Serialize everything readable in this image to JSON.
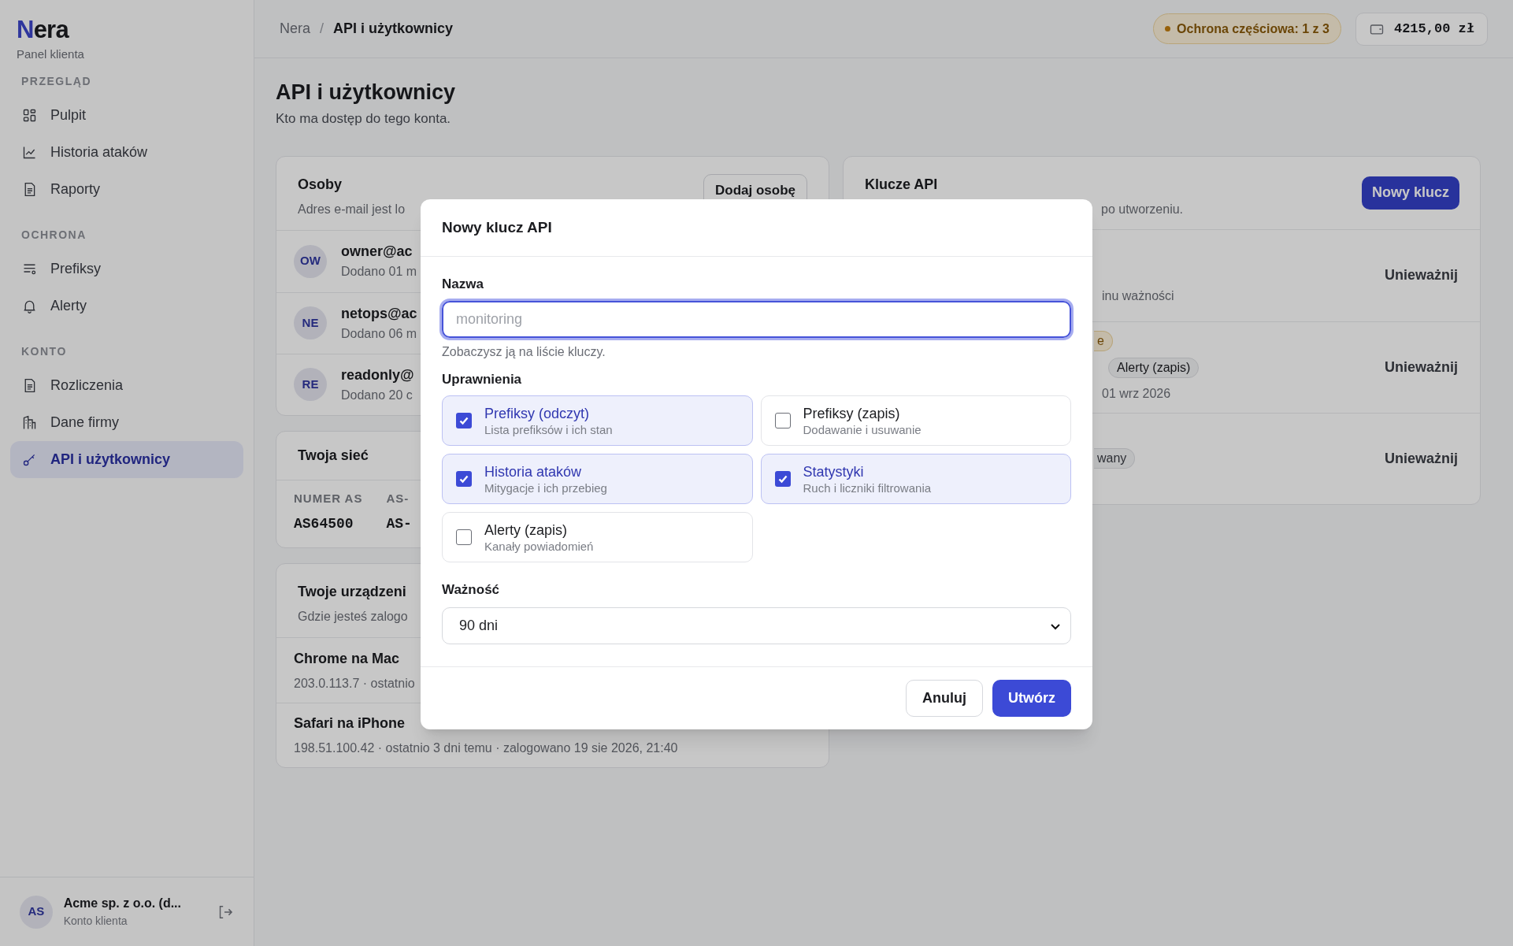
{
  "sidebar": {
    "logo": "Nera",
    "subtitle": "Panel klienta",
    "sections": [
      {
        "heading": "PRZEGLĄD",
        "items": [
          {
            "label": "Pulpit",
            "selected": false
          },
          {
            "label": "Historia ataków",
            "selected": false
          },
          {
            "label": "Raporty",
            "selected": false
          }
        ]
      },
      {
        "heading": "OCHRONA",
        "items": [
          {
            "label": "Prefiksy",
            "selected": false
          },
          {
            "label": "Alerty",
            "selected": false
          }
        ]
      },
      {
        "heading": "KONTO",
        "items": [
          {
            "label": "Rozliczenia",
            "selected": false
          },
          {
            "label": "Dane firmy",
            "selected": false
          },
          {
            "label": "API i użytkownicy",
            "selected": true
          }
        ]
      }
    ],
    "account": {
      "initials": "AS",
      "name": "Acme sp. z o.o. (d...",
      "role": "Konto klienta"
    }
  },
  "topbar": {
    "breadcrumb": [
      "Nera",
      "/",
      "API i użytkownicy"
    ],
    "protection_badge": "Ochrona częściowa: 1 z 3",
    "balance": "4215,00 zł"
  },
  "page": {
    "title": "API i użytkownicy",
    "subtitle": "Kto ma dostęp do tego konta."
  },
  "people_card": {
    "title": "Osoby",
    "subtitle": "Adres e-mail jest lo",
    "button": "Dodaj osobę",
    "rows": [
      {
        "initials": "OW",
        "email": "owner@ac",
        "added": "Dodano 01 m"
      },
      {
        "initials": "NE",
        "email": "netops@ac",
        "added": "Dodano 06 m"
      },
      {
        "initials": "RE",
        "email": "readonly@",
        "added": "Dodano 20 c"
      }
    ]
  },
  "network_card": {
    "title": "Twoja sieć",
    "fields": [
      {
        "label": "NUMER AS",
        "value": "AS64500"
      },
      {
        "label": "AS-",
        "value": "AS-"
      }
    ]
  },
  "devices_card": {
    "title": "Twoje urządzeni",
    "subtitle": "Gdzie jesteś zalogo",
    "rows": [
      {
        "name": "Chrome na Mac",
        "details": "203.0.113.7 · ostatnio"
      },
      {
        "name": "Safari na iPhone",
        "details": "198.51.100.42 · ostatnio 3 dni temu · zalogowano 19 sie 2026, 21:40"
      }
    ]
  },
  "keys_card": {
    "title": "Klucze API",
    "subtitle": "po utworzeniu.",
    "button": "Nowy klucz",
    "rows": [
      {
        "note": "inu ważności",
        "action": "Unieważnij"
      },
      {
        "status": {
          "text": "e",
          "kind": "warning"
        },
        "tags": [
          "Alerty (zapis)"
        ],
        "note": "01 wrz 2026",
        "action": "Unieważnij"
      },
      {
        "status": {
          "text": "wany",
          "kind": "neutral"
        },
        "action": "Unieważnij"
      }
    ]
  },
  "modal": {
    "title": "Nowy klucz API",
    "name_label": "Nazwa",
    "name_placeholder": "monitoring",
    "name_hint": "Zobaczysz ją na liście kluczy.",
    "permissions_label": "Uprawnienia",
    "permissions": [
      {
        "title": "Prefiksy (odczyt)",
        "description": "Lista prefiksów i ich stan",
        "checked": true
      },
      {
        "title": "Prefiksy (zapis)",
        "description": "Dodawanie i usuwanie",
        "checked": false
      },
      {
        "title": "Historia ataków",
        "description": "Mitygacje i ich przebieg",
        "checked": true
      },
      {
        "title": "Statystyki",
        "description": "Ruch i liczniki filtrowania",
        "checked": true
      },
      {
        "title": "Alerty (zapis)",
        "description": "Kanały powiadomień",
        "checked": false
      }
    ],
    "validity_label": "Ważność",
    "validity_value": "90 dni",
    "buttons": [
      {
        "label": "Anuluj",
        "kind": "secondary"
      },
      {
        "label": "Utwórz",
        "kind": "primary"
      }
    ]
  }
}
